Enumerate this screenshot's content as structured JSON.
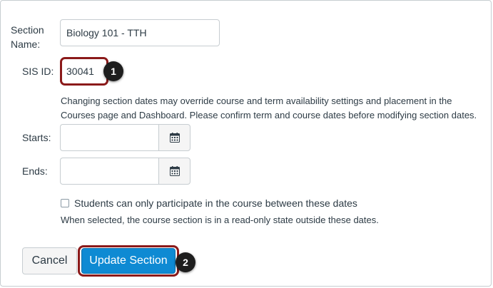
{
  "form": {
    "section_name_label": "Section Name:",
    "section_name_value": "Biology 101 - TTH",
    "sis_id_label": "SIS ID:",
    "sis_id_value": "30041",
    "help_text": "Changing section dates may override course and term availability settings and placement in the Courses page and Dashboard. Please confirm term and course dates before modifying section dates.",
    "starts_label": "Starts:",
    "starts_value": "",
    "ends_label": "Ends:",
    "ends_value": "",
    "restrict_checkbox_label": "Students can only participate in the course between these dates",
    "restrict_checkbox_checked": false,
    "restrict_help": "When selected, the course section is in a read-only state outside these dates."
  },
  "buttons": {
    "cancel_label": "Cancel",
    "update_label": "Update Section"
  },
  "callouts": [
    "1",
    "2"
  ],
  "icons": {
    "calendar": "calendar-icon"
  },
  "colors": {
    "primary": "#0e8ad3",
    "highlight": "#8b1a1a",
    "callout_bg": "#1e1e1e"
  }
}
